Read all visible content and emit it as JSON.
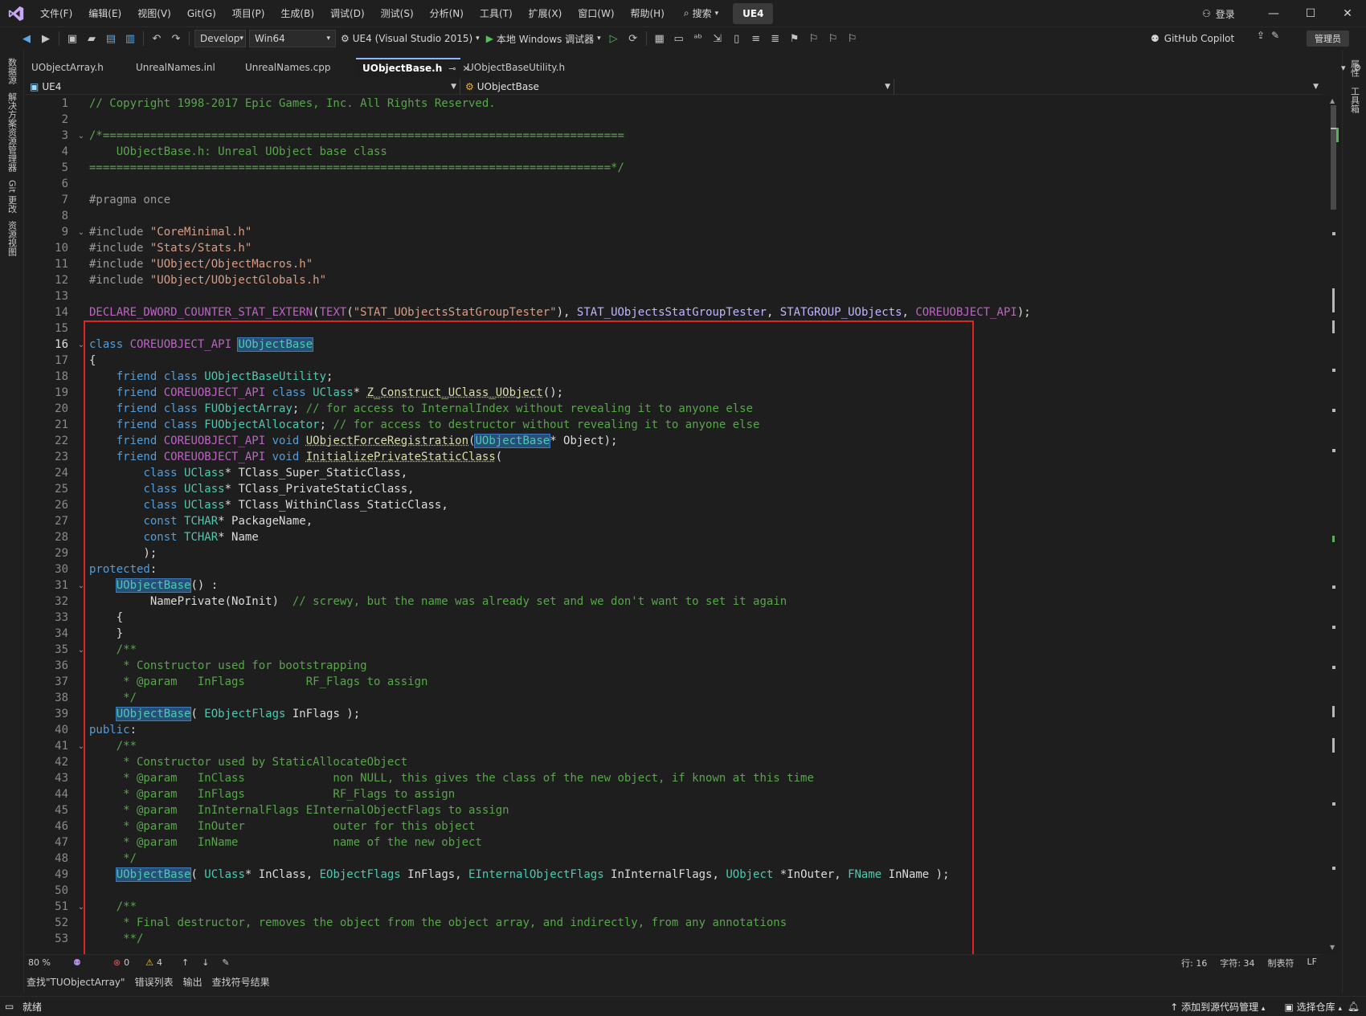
{
  "menu": [
    "文件(F)",
    "编辑(E)",
    "视图(V)",
    "Git(G)",
    "项目(P)",
    "生成(B)",
    "调试(D)",
    "测试(S)",
    "分析(N)",
    "工具(T)",
    "扩展(X)",
    "窗口(W)",
    "帮助(H)"
  ],
  "search_label": "搜索",
  "solution_badge": "UE4",
  "login_label": "登录",
  "toolbar": {
    "config": "Develop",
    "platform": "Win64",
    "startup_project": "UE4 (Visual Studio 2015)",
    "debugger": "本地 Windows 调试器",
    "copilot": "GitHub Copilot",
    "admin": "管理员"
  },
  "left_panels": [
    "数据源",
    "解决方案资源管理器",
    "Git 更改",
    "资源视图"
  ],
  "right_panels": [
    "属性",
    "工具箱"
  ],
  "tabs": [
    {
      "label": "UObjectArray.h",
      "active": false
    },
    {
      "label": "UnrealNames.inl",
      "active": false
    },
    {
      "label": "UnrealNames.cpp",
      "active": false
    },
    {
      "label": "UObjectBase.h",
      "active": true
    },
    {
      "label": "UObjectBaseUtility.h",
      "active": false
    }
  ],
  "nav": {
    "project": "UE4",
    "scope": "UObjectBase"
  },
  "code_lines": [
    {
      "n": "1",
      "parts": [
        [
          "cm",
          "// Copyright 1998-2017 Epic Games, Inc. All Rights Reserved."
        ]
      ]
    },
    {
      "n": "2",
      "parts": []
    },
    {
      "n": "3",
      "fold": "⌄",
      "parts": [
        [
          "cm",
          "/*============================================================================="
        ]
      ]
    },
    {
      "n": "4",
      "parts": [
        [
          "cm",
          "    UObjectBase.h: Unreal UObject base class"
        ]
      ]
    },
    {
      "n": "5",
      "parts": [
        [
          "cm",
          "=============================================================================*/"
        ]
      ]
    },
    {
      "n": "6",
      "parts": []
    },
    {
      "n": "7",
      "parts": [
        [
          "pp",
          "#pragma once"
        ]
      ]
    },
    {
      "n": "8",
      "parts": []
    },
    {
      "n": "9",
      "fold": "⌄",
      "parts": [
        [
          "pp",
          "#include "
        ],
        [
          "st",
          "\"CoreMinimal.h\""
        ]
      ]
    },
    {
      "n": "10",
      "parts": [
        [
          "pp",
          "#include "
        ],
        [
          "st",
          "\"Stats/Stats.h\""
        ]
      ]
    },
    {
      "n": "11",
      "parts": [
        [
          "pp",
          "#include "
        ],
        [
          "st",
          "\"UObject/ObjectMacros.h\""
        ]
      ]
    },
    {
      "n": "12",
      "parts": [
        [
          "pp",
          "#include "
        ],
        [
          "st",
          "\"UObject/UObjectGlobals.h\""
        ]
      ]
    },
    {
      "n": "13",
      "parts": []
    },
    {
      "n": "14",
      "parts": [
        [
          "mc",
          "DECLARE_DWORD_COUNTER_STAT_EXTERN"
        ],
        [
          "dt",
          "("
        ],
        [
          "mc",
          "TEXT"
        ],
        [
          "dt",
          "("
        ],
        [
          "st",
          "\"STAT_UObjectsStatGroupTester\""
        ],
        [
          "dt",
          "), "
        ],
        [
          "mx",
          "STAT_UObjectsStatGroupTester"
        ],
        [
          "dt",
          ", "
        ],
        [
          "mx",
          "STATGROUP_UObjects"
        ],
        [
          "dt",
          ", "
        ],
        [
          "mc",
          "COREUOBJECT_API"
        ],
        [
          "dt",
          ");"
        ]
      ]
    },
    {
      "n": "15",
      "parts": []
    },
    {
      "n": "16",
      "cur": true,
      "fold": "⌄",
      "parts": [
        [
          "kw",
          "class "
        ],
        [
          "mc",
          "COREUOBJECT_API "
        ],
        [
          "hl",
          "UObjectBase"
        ]
      ]
    },
    {
      "n": "17",
      "parts": [
        [
          "dt",
          "{"
        ]
      ]
    },
    {
      "n": "18",
      "parts": [
        [
          "dt",
          "    "
        ],
        [
          "kw",
          "friend class "
        ],
        [
          "ty",
          "UObjectBaseUtility"
        ],
        [
          "dt",
          ";"
        ]
      ]
    },
    {
      "n": "19",
      "parts": [
        [
          "dt",
          "    "
        ],
        [
          "kw",
          "friend "
        ],
        [
          "mc",
          "COREUOBJECT_API "
        ],
        [
          "kw",
          "class "
        ],
        [
          "ty",
          "UClass"
        ],
        [
          "dt",
          "* "
        ],
        [
          "fn",
          "Z_Construct_UClass_UObject"
        ],
        [
          "dt",
          "();"
        ]
      ]
    },
    {
      "n": "20",
      "parts": [
        [
          "dt",
          "    "
        ],
        [
          "kw",
          "friend class "
        ],
        [
          "ty",
          "FUObjectArray"
        ],
        [
          "dt",
          "; "
        ],
        [
          "cm",
          "// for access to InternalIndex without revealing it to anyone else"
        ]
      ]
    },
    {
      "n": "21",
      "parts": [
        [
          "dt",
          "    "
        ],
        [
          "kw",
          "friend class "
        ],
        [
          "ty",
          "FUObjectAllocator"
        ],
        [
          "dt",
          "; "
        ],
        [
          "cm",
          "// for access to destructor without revealing it to anyone else"
        ]
      ]
    },
    {
      "n": "22",
      "parts": [
        [
          "dt",
          "    "
        ],
        [
          "kw",
          "friend "
        ],
        [
          "mc",
          "COREUOBJECT_API "
        ],
        [
          "kw",
          "void "
        ],
        [
          "fn",
          "UObjectForceRegistration"
        ],
        [
          "dt",
          "("
        ],
        [
          "hl",
          "UObjectBase"
        ],
        [
          "dt",
          "* Object);"
        ]
      ]
    },
    {
      "n": "23",
      "parts": [
        [
          "dt",
          "    "
        ],
        [
          "kw",
          "friend "
        ],
        [
          "mc",
          "COREUOBJECT_API "
        ],
        [
          "kw",
          "void "
        ],
        [
          "fn",
          "InitializePrivateStaticClass"
        ],
        [
          "dt",
          "("
        ]
      ]
    },
    {
      "n": "24",
      "parts": [
        [
          "dt",
          "        "
        ],
        [
          "kw",
          "class "
        ],
        [
          "ty",
          "UClass"
        ],
        [
          "dt",
          "* TClass_Super_StaticClass,"
        ]
      ]
    },
    {
      "n": "25",
      "parts": [
        [
          "dt",
          "        "
        ],
        [
          "kw",
          "class "
        ],
        [
          "ty",
          "UClass"
        ],
        [
          "dt",
          "* TClass_PrivateStaticClass,"
        ]
      ]
    },
    {
      "n": "26",
      "parts": [
        [
          "dt",
          "        "
        ],
        [
          "kw",
          "class "
        ],
        [
          "ty",
          "UClass"
        ],
        [
          "dt",
          "* TClass_WithinClass_StaticClass,"
        ]
      ]
    },
    {
      "n": "27",
      "parts": [
        [
          "dt",
          "        "
        ],
        [
          "kw",
          "const "
        ],
        [
          "ty",
          "TCHAR"
        ],
        [
          "dt",
          "* PackageName,"
        ]
      ]
    },
    {
      "n": "28",
      "parts": [
        [
          "dt",
          "        "
        ],
        [
          "kw",
          "const "
        ],
        [
          "ty",
          "TCHAR"
        ],
        [
          "dt",
          "* Name"
        ]
      ]
    },
    {
      "n": "29",
      "parts": [
        [
          "dt",
          "        );"
        ]
      ]
    },
    {
      "n": "30",
      "parts": [
        [
          "kw",
          "protected"
        ],
        [
          "dt",
          ":"
        ]
      ]
    },
    {
      "n": "31",
      "fold": "⌄",
      "parts": [
        [
          "dt",
          "    "
        ],
        [
          "hl",
          "UObjectBase"
        ],
        [
          "dt",
          "() :"
        ]
      ]
    },
    {
      "n": "32",
      "parts": [
        [
          "dt",
          "         NamePrivate(NoInit)  "
        ],
        [
          "cm",
          "// screwy, but the name was already set and we don't want to set it again"
        ]
      ]
    },
    {
      "n": "33",
      "parts": [
        [
          "dt",
          "    {"
        ]
      ]
    },
    {
      "n": "34",
      "parts": [
        [
          "dt",
          "    }"
        ]
      ]
    },
    {
      "n": "35",
      "fold": "⌄",
      "parts": [
        [
          "dt",
          "    "
        ],
        [
          "cm",
          "/**"
        ]
      ]
    },
    {
      "n": "36",
      "parts": [
        [
          "cm",
          "     * Constructor used for bootstrapping"
        ]
      ]
    },
    {
      "n": "37",
      "parts": [
        [
          "cm",
          "     * @param   InFlags         RF_Flags to assign"
        ]
      ]
    },
    {
      "n": "38",
      "parts": [
        [
          "cm",
          "     */"
        ]
      ]
    },
    {
      "n": "39",
      "parts": [
        [
          "dt",
          "    "
        ],
        [
          "hl",
          "UObjectBase"
        ],
        [
          "dt",
          "( "
        ],
        [
          "ty",
          "EObjectFlags"
        ],
        [
          "dt",
          " InFlags );"
        ]
      ]
    },
    {
      "n": "40",
      "parts": [
        [
          "kw",
          "public"
        ],
        [
          "dt",
          ":"
        ]
      ]
    },
    {
      "n": "41",
      "fold": "⌄",
      "parts": [
        [
          "dt",
          "    "
        ],
        [
          "cm",
          "/**"
        ]
      ]
    },
    {
      "n": "42",
      "parts": [
        [
          "cm",
          "     * Constructor used by StaticAllocateObject"
        ]
      ]
    },
    {
      "n": "43",
      "parts": [
        [
          "cm",
          "     * @param   InClass             non NULL, this gives the class of the new object, if known at this time"
        ]
      ]
    },
    {
      "n": "44",
      "parts": [
        [
          "cm",
          "     * @param   InFlags             RF_Flags to assign"
        ]
      ]
    },
    {
      "n": "45",
      "parts": [
        [
          "cm",
          "     * @param   InInternalFlags EInternalObjectFlags to assign"
        ]
      ]
    },
    {
      "n": "46",
      "parts": [
        [
          "cm",
          "     * @param   InOuter             outer for this object"
        ]
      ]
    },
    {
      "n": "47",
      "parts": [
        [
          "cm",
          "     * @param   InName              name of the new object"
        ]
      ]
    },
    {
      "n": "48",
      "parts": [
        [
          "cm",
          "     */"
        ]
      ]
    },
    {
      "n": "49",
      "parts": [
        [
          "dt",
          "    "
        ],
        [
          "hl",
          "UObjectBase"
        ],
        [
          "dt",
          "( "
        ],
        [
          "ty",
          "UClass"
        ],
        [
          "dt",
          "* InClass, "
        ],
        [
          "ty",
          "EObjectFlags"
        ],
        [
          "dt",
          " InFlags, "
        ],
        [
          "ty",
          "EInternalObjectFlags"
        ],
        [
          "dt",
          " InInternalFlags, "
        ],
        [
          "ty",
          "UObject"
        ],
        [
          "dt",
          " *InOuter, "
        ],
        [
          "ty",
          "FName"
        ],
        [
          "dt",
          " InName );"
        ]
      ]
    },
    {
      "n": "50",
      "parts": []
    },
    {
      "n": "51",
      "fold": "⌄",
      "parts": [
        [
          "dt",
          "    "
        ],
        [
          "cm",
          "/**"
        ]
      ]
    },
    {
      "n": "52",
      "parts": [
        [
          "cm",
          "     * Final destructor, removes the object from the object array, and indirectly, from any annotations"
        ]
      ]
    },
    {
      "n": "53",
      "parts": [
        [
          "cm",
          "     **/"
        ]
      ]
    }
  ],
  "editor_status": {
    "zoom": "80 %",
    "errors": "0",
    "warnings": "4",
    "line": "行: 16",
    "char": "字符: 34",
    "tabs": "制表符",
    "eol": "LF"
  },
  "bottom_tabs": [
    "查找\"TUObjectArray\"",
    "错误列表",
    "输出",
    "查找符号结果"
  ],
  "status": {
    "ready": "就绪",
    "source_control": "添加到源代码管理",
    "repo": "选择仓库"
  },
  "colors": {
    "comment": "#57a64a",
    "keyword": "#569cd6",
    "type": "#4ec9b0",
    "string": "#d69d85",
    "macro": "#bd63c5",
    "highlight_box": "#e02424"
  }
}
